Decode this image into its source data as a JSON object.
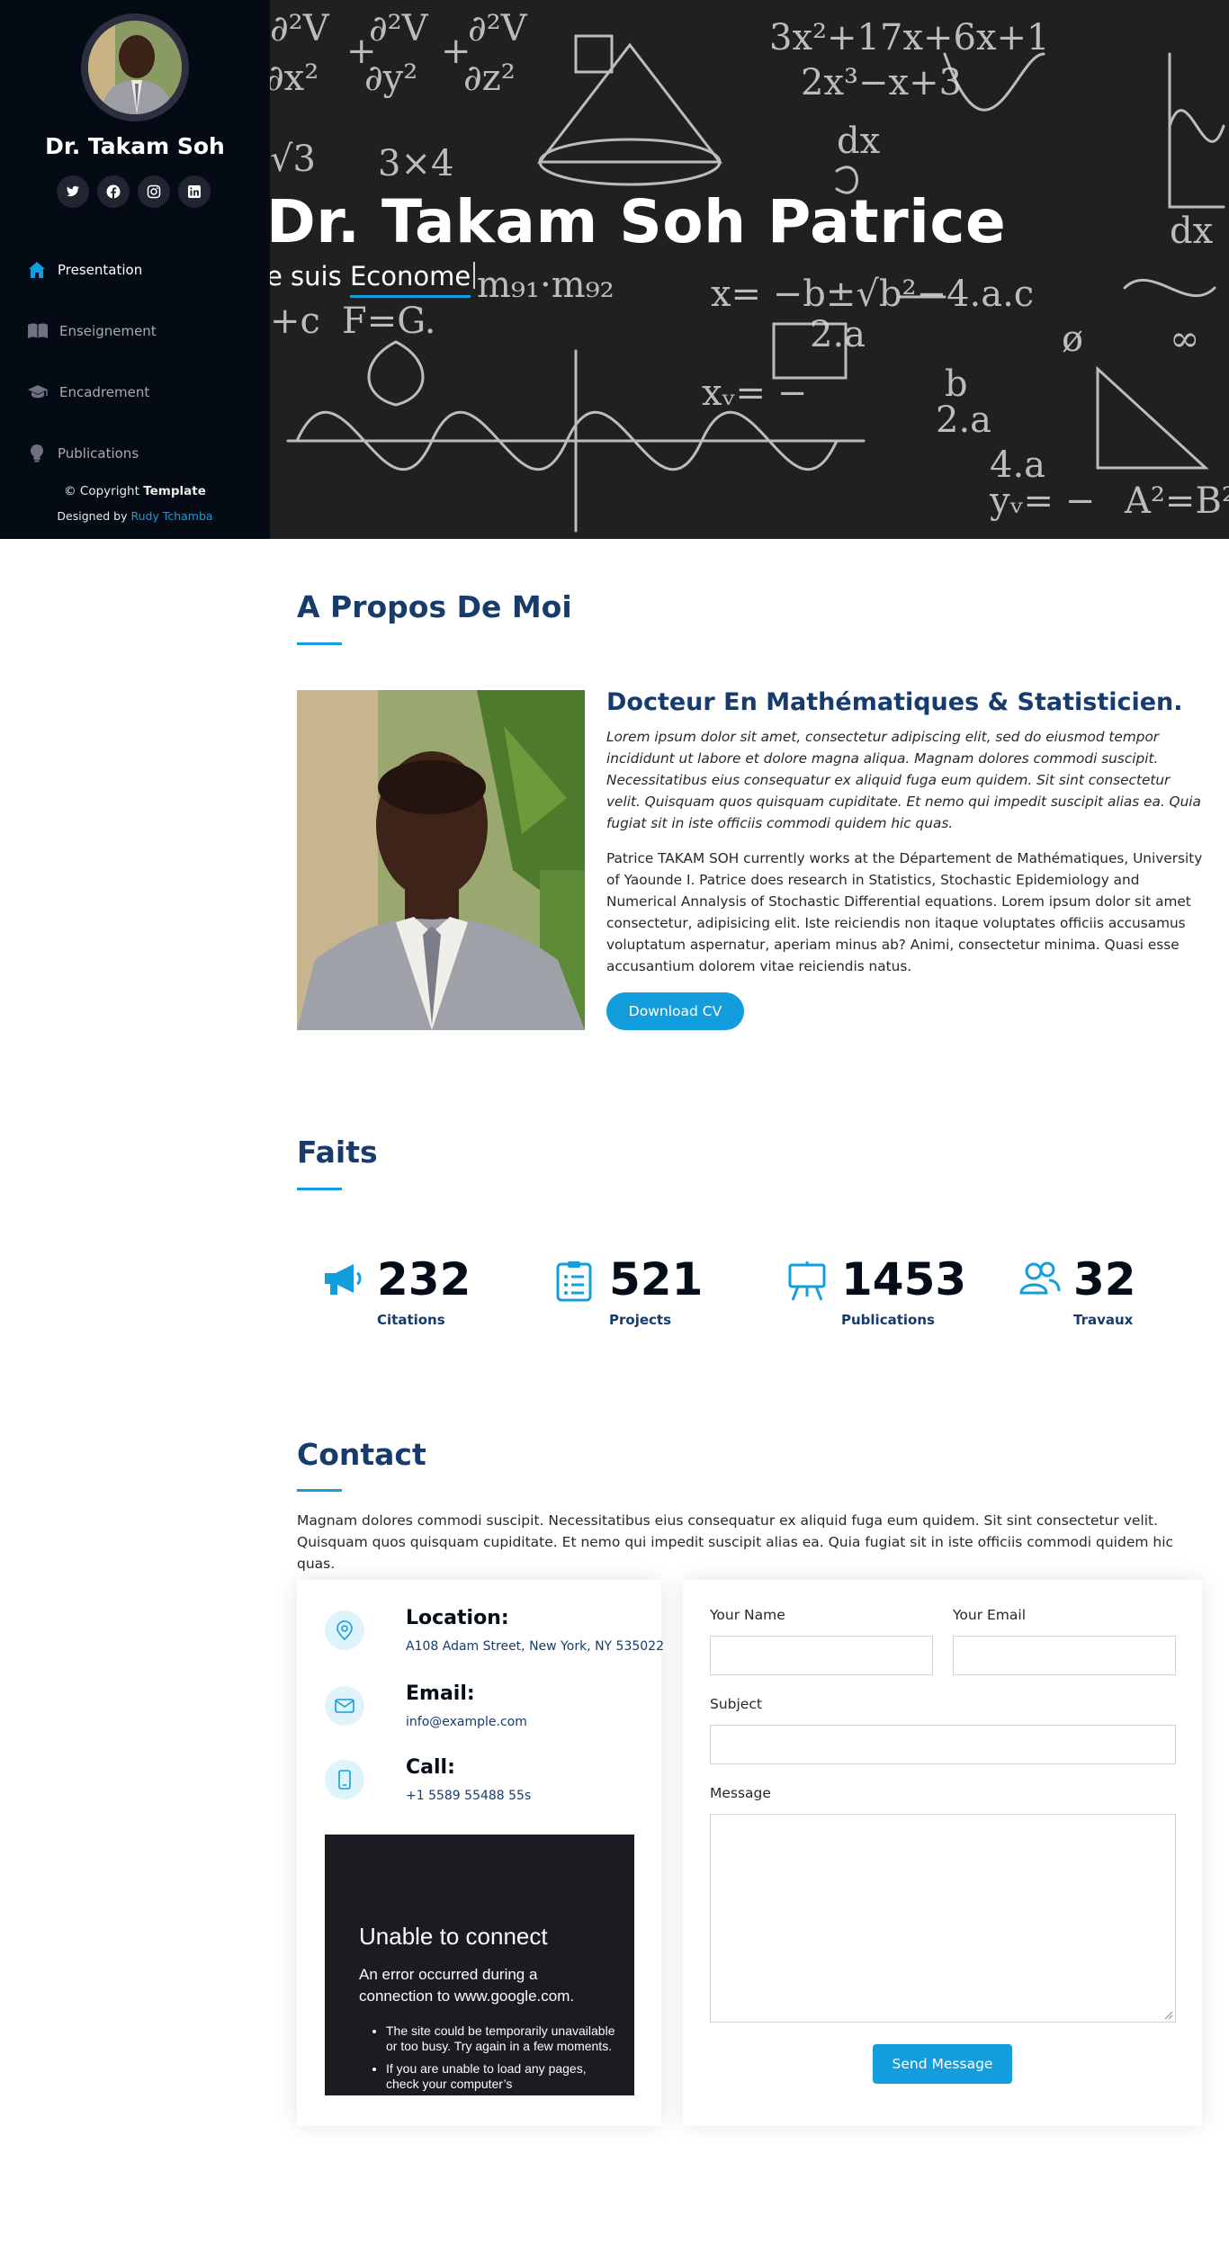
{
  "sidebar": {
    "name": "Dr. Takam Soh",
    "socials": [
      "twitter-icon",
      "facebook-icon",
      "instagram-icon",
      "linkedin-icon"
    ],
    "nav": [
      {
        "label": "Presentation",
        "icon": "home-icon",
        "active": true
      },
      {
        "label": "Enseignement",
        "icon": "book-icon",
        "active": false
      },
      {
        "label": "Encadrement",
        "icon": "graduation-cap-icon",
        "active": false
      },
      {
        "label": "Publications",
        "icon": "lightbulb-icon",
        "active": false
      }
    ],
    "copyright_prefix": "© Copyright",
    "copyright_brand": "Template",
    "designed_prefix": "Designed by",
    "designed_author": "Rudy Tchamba"
  },
  "hero": {
    "title": "Dr. Takam Soh Patrice",
    "subtitle_prefix": "e suis",
    "subtitle_typed": "Econome"
  },
  "about": {
    "title": "A Propos De Moi",
    "heading": "Docteur En Mathématiques & Statisticien.",
    "italic": "Lorem ipsum dolor sit amet, consectetur adipiscing elit, sed do eiusmod tempor incididunt ut labore et dolore magna aliqua. Magnam dolores commodi suscipit. Necessitatibus eius consequatur ex aliquid fuga eum quidem. Sit sint consectetur velit. Quisquam quos quisquam cupiditate. Et nemo qui impedit suscipit alias ea. Quia fugiat sit in iste officiis commodi quidem hic quas.",
    "text": "Patrice TAKAM SOH currently works at the Département de Mathématiques, University of Yaounde I. Patrice does research in Statistics, Stochastic Epidemiology and Numerical Annalysis of Stochastic Differential equations. Lorem ipsum dolor sit amet consectetur, adipisicing elit. Iste reiciendis non itaque voluptates officiis accusamus voluptatum aspernatur, aperiam minus ab? Animi, consectetur minima. Quasi esse accusantium dolorem vitae reiciendis natus.",
    "cv_button": "Download CV"
  },
  "facts": {
    "title": "Faits",
    "items": [
      {
        "value": "232",
        "label": "Citations",
        "icon": "megaphone-icon"
      },
      {
        "value": "521",
        "label": "Projects",
        "icon": "clipboard-icon"
      },
      {
        "value": "1453",
        "label": "Publications",
        "icon": "easel-icon"
      },
      {
        "value": "32",
        "label": "Travaux",
        "icon": "people-icon"
      }
    ]
  },
  "contact": {
    "title": "Contact",
    "text": "Magnam dolores commodi suscipit. Necessitatibus eius consequatur ex aliquid fuga eum quidem. Sit sint consectetur velit. Quisquam quos quisquam cupiditate. Et nemo qui impedit suscipit alias ea. Quia fugiat sit in iste officiis commodi quidem hic quas.",
    "location_title": "Location:",
    "location_value": "A108 Adam Street, New York, NY 535022",
    "email_title": "Email:",
    "email_value": "info@example.com",
    "call_title": "Call:",
    "call_value": "+1 5589 55488 55s",
    "map_error": {
      "title": "Unable to connect",
      "text": "An error occurred during a connection to www.google.com.",
      "bullets": [
        "The site could be temporarily unavailable or too busy. Try again in a few moments.",
        "If you are unable to load any pages, check your computer’s"
      ]
    },
    "form": {
      "name_label": "Your Name",
      "email_label": "Your Email",
      "subject_label": "Subject",
      "message_label": "Message",
      "send_button": "Send Message"
    }
  },
  "colors": {
    "accent": "#149ddd",
    "navy": "#173b6c",
    "sidebar_bg": "#040b14"
  }
}
